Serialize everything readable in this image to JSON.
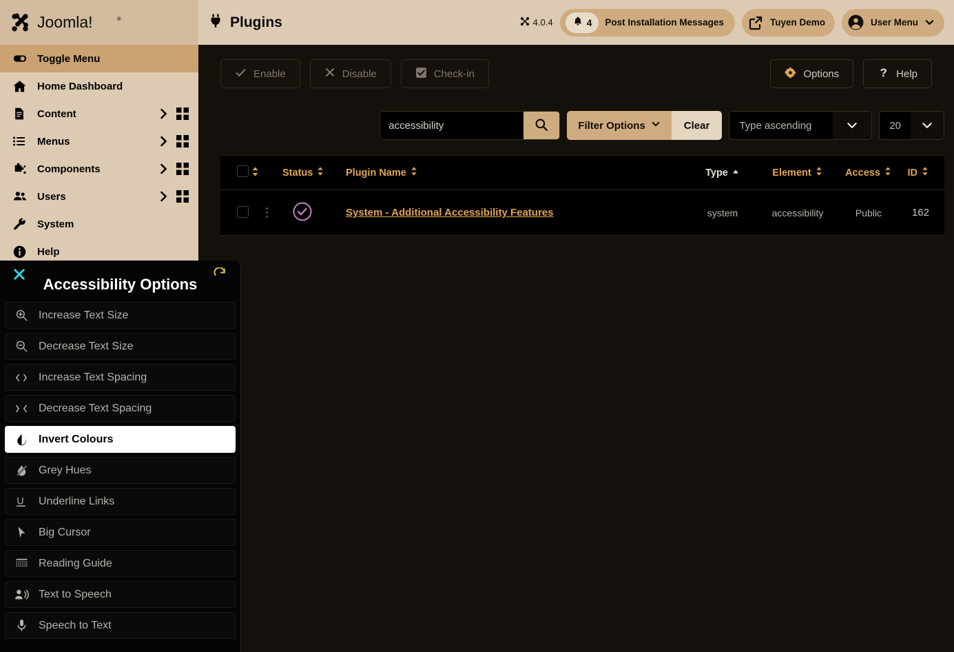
{
  "brand": {
    "name": "Joomla!",
    "logo_icon": "joomla-logo-icon"
  },
  "sidebar": {
    "toggle": {
      "label": "Toggle Menu",
      "icon": "toggle-icon"
    },
    "items": [
      {
        "label": "Home Dashboard",
        "icon": "home-icon",
        "arrow": false,
        "grid": false
      },
      {
        "label": "Content",
        "icon": "content-icon",
        "arrow": true,
        "grid": true
      },
      {
        "label": "Menus",
        "icon": "menus-icon",
        "arrow": true,
        "grid": true
      },
      {
        "label": "Components",
        "icon": "components-icon",
        "arrow": true,
        "grid": true
      },
      {
        "label": "Users",
        "icon": "users-icon",
        "arrow": true,
        "grid": true
      },
      {
        "label": "System",
        "icon": "wrench-icon",
        "arrow": false,
        "grid": false
      },
      {
        "label": "Help",
        "icon": "info-icon",
        "arrow": false,
        "grid": false
      }
    ]
  },
  "header": {
    "title": "Plugins",
    "title_icon": "plug-icon",
    "version": "4.0.4",
    "version_icon": "joomla-mark-icon",
    "notifications": {
      "count": "4",
      "label": "Post Installation Messages",
      "icon": "bell-icon"
    },
    "site": {
      "label": "Tuyen Demo",
      "icon": "external-link-icon"
    },
    "user": {
      "label": "User Menu",
      "icon": "user-circle-icon",
      "caret": "chevron-down-icon"
    }
  },
  "toolbar": {
    "enable": {
      "label": "Enable",
      "icon": "check-icon"
    },
    "disable": {
      "label": "Disable",
      "icon": "x-icon"
    },
    "checkin": {
      "label": "Check-in",
      "icon": "checkbox-icon"
    },
    "options": {
      "label": "Options",
      "icon": "gear-icon"
    },
    "help": {
      "label": "Help",
      "icon": "question-icon"
    }
  },
  "filters": {
    "search_value": "accessibility",
    "search_placeholder": "Search",
    "search_icon": "search-icon",
    "filter_options_label": "Filter Options",
    "clear_label": "Clear",
    "sort_value": "Type ascending",
    "limit_value": "20"
  },
  "table": {
    "columns": {
      "checkbox": "",
      "ordering": "",
      "status": "Status",
      "name": "Plugin Name",
      "type": "Type",
      "element": "Element",
      "access": "Access",
      "id": "ID"
    },
    "sorted_column": "Type",
    "sort_direction": "ascending",
    "rows": [
      {
        "name": "System - Additional Accessibility Features",
        "status": "enabled",
        "status_icon": "check-circle-icon",
        "type": "system",
        "element": "accessibility",
        "access": "Public",
        "id": "162"
      }
    ]
  },
  "accessibility_panel": {
    "title": "Accessibility Options",
    "close_icon": "close-icon",
    "reset_icon": "reset-icon",
    "items": [
      {
        "label": "Increase Text Size",
        "icon": "zoom-in-icon",
        "active": false
      },
      {
        "label": "Decrease Text Size",
        "icon": "zoom-out-icon",
        "active": false
      },
      {
        "label": "Increase Text Spacing",
        "icon": "expand-horizontal-icon",
        "active": false
      },
      {
        "label": "Decrease Text Spacing",
        "icon": "contract-horizontal-icon",
        "active": false
      },
      {
        "label": "Invert Colours",
        "icon": "invert-colours-icon",
        "active": true
      },
      {
        "label": "Grey Hues",
        "icon": "grey-hues-icon",
        "active": false
      },
      {
        "label": "Underline Links",
        "icon": "underline-icon",
        "active": false
      },
      {
        "label": "Big Cursor",
        "icon": "cursor-icon",
        "active": false
      },
      {
        "label": "Reading Guide",
        "icon": "reading-guide-icon",
        "active": false
      },
      {
        "label": "Text to Speech",
        "icon": "text-to-speech-icon",
        "active": false
      },
      {
        "label": "Speech to Text",
        "icon": "microphone-icon",
        "active": false
      }
    ]
  },
  "colors": {
    "sidebar_bg": "#ddcab3",
    "accent_tan": "#cfac80",
    "link_orange": "#e0a458",
    "status_purple": "#c77fc0",
    "close_cyan": "#36d6e0",
    "reset_yellow": "#d6c447"
  }
}
